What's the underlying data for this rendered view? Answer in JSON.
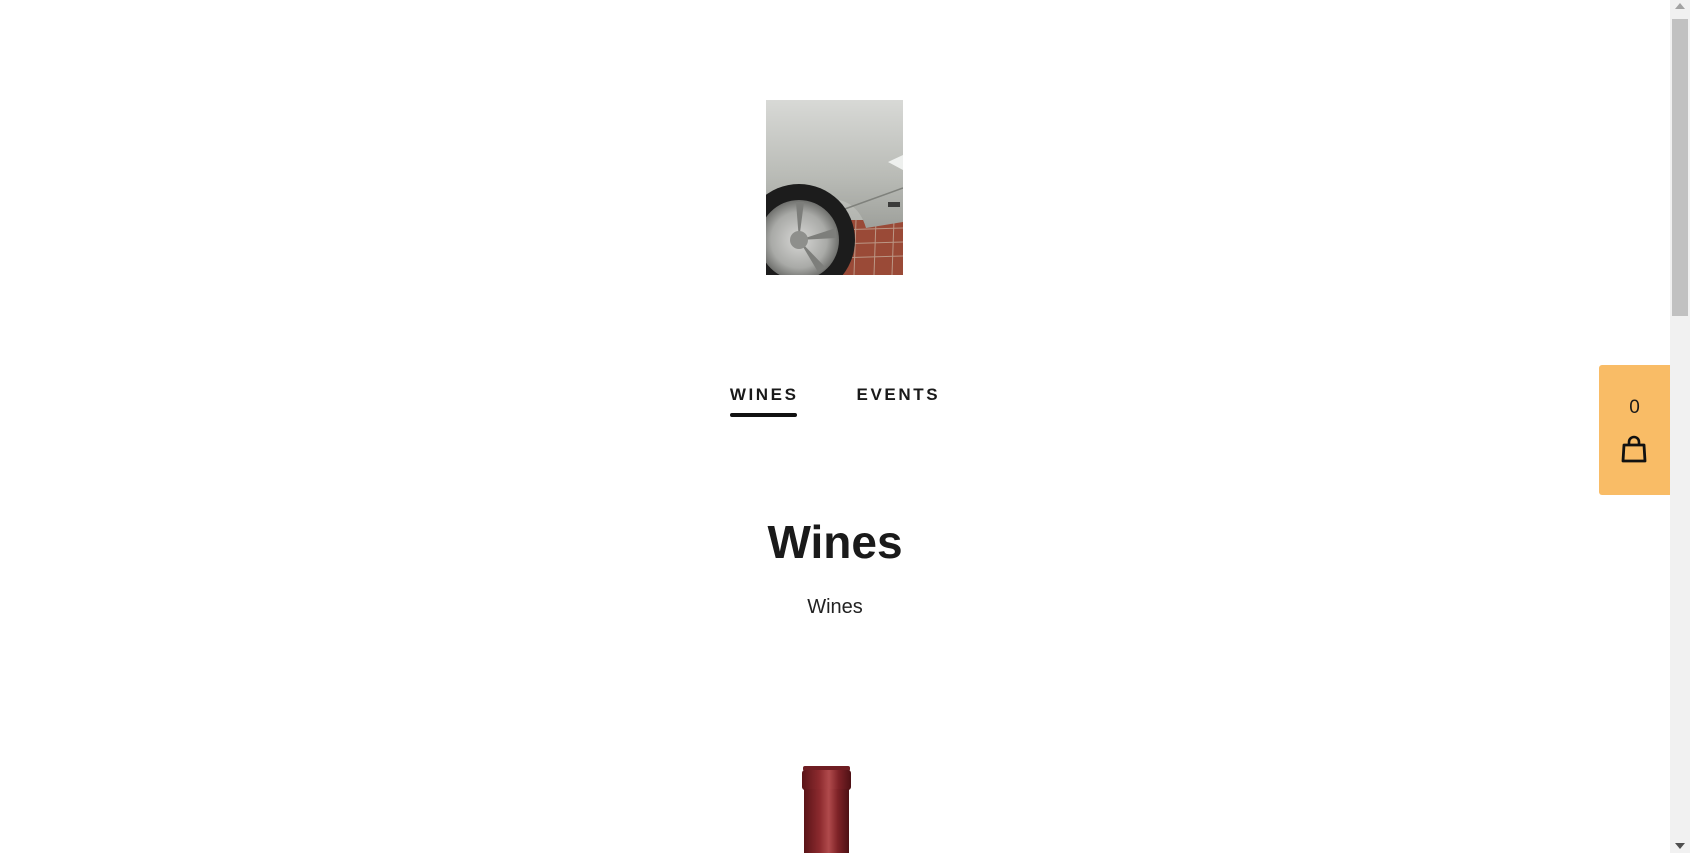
{
  "header": {
    "logo_alt": "logo"
  },
  "nav": {
    "items": [
      {
        "label": "WINES",
        "active": true
      },
      {
        "label": "EVENTS",
        "active": false
      }
    ]
  },
  "main": {
    "title": "Wines",
    "subtitle": "Wines"
  },
  "cart": {
    "count": "0",
    "icon": "shopping-bag-icon",
    "color": "#f9bc66"
  }
}
